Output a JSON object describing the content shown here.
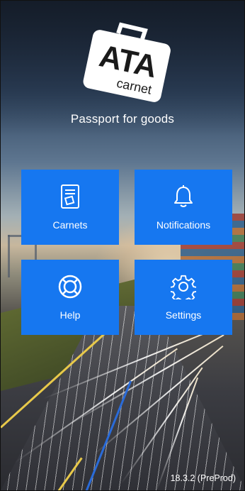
{
  "app": {
    "logo_text": "ATA",
    "logo_subtext": "carnet",
    "tagline": "Passport for goods"
  },
  "tiles": [
    {
      "label": "Carnets",
      "icon": "document-icon"
    },
    {
      "label": "Notifications",
      "icon": "bell-icon"
    },
    {
      "label": "Help",
      "icon": "lifebuoy-icon"
    },
    {
      "label": "Settings",
      "icon": "gear-icon"
    }
  ],
  "footer": {
    "version": "18.3.2 (PreProd)"
  },
  "colors": {
    "tile": "#1677f0",
    "text": "#ffffff"
  }
}
